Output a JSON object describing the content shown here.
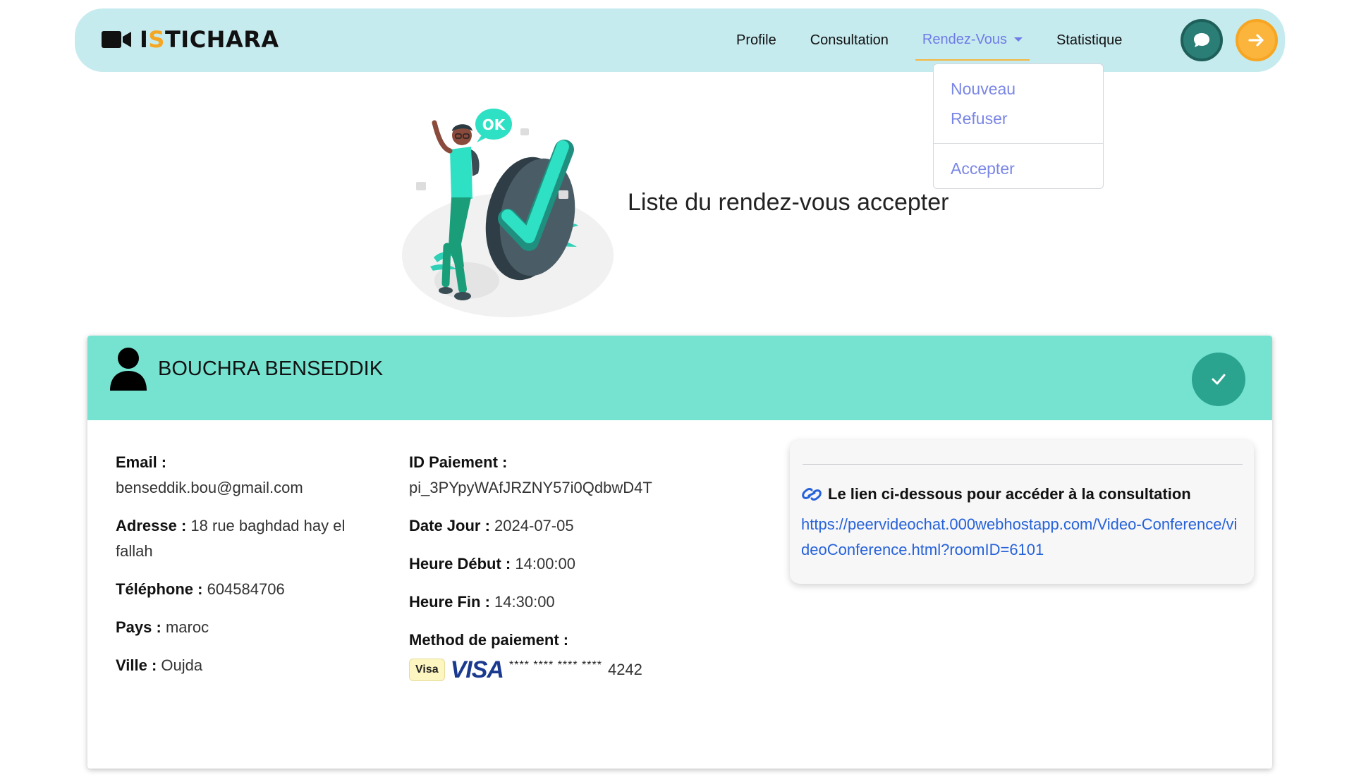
{
  "brand": {
    "prefix": "I",
    "accent": "S",
    "rest": "TICHARA",
    "icon": "video-camera-icon"
  },
  "nav": {
    "items": [
      {
        "label": "Profile"
      },
      {
        "label": "Consultation"
      },
      {
        "label": "Rendez-Vous",
        "active": true
      },
      {
        "label": "Statistique"
      }
    ],
    "chat_icon": "chat-bubble-icon",
    "logout_icon": "arrow-right-icon"
  },
  "dropdown": {
    "items": [
      {
        "label": "Nouveau"
      },
      {
        "label": "Refuser"
      },
      {
        "label": "Accepter"
      }
    ]
  },
  "hero": {
    "title": "Liste du rendez-vous accepter",
    "bubble": "OK"
  },
  "card": {
    "name": "BOUCHRA BENSEDDIK",
    "status_icon": "check-icon",
    "patient": {
      "email_label": "Email :",
      "email": "benseddik.bou@gmail.com",
      "address_label": "Adresse :",
      "address": "18 rue baghdad hay el fallah",
      "phone_label": "Téléphone :",
      "phone": "604584706",
      "country_label": "Pays :",
      "country": "maroc",
      "city_label": "Ville :",
      "city": "Oujda"
    },
    "payment": {
      "id_label": "ID Paiement :",
      "id": "pi_3PYpyWAfJRZNY57i0QdbwD4T",
      "date_label": "Date Jour :",
      "date": "2024-07-05",
      "start_label": "Heure Début :",
      "start": "14:00:00",
      "end_label": "Heure Fin :",
      "end": "14:30:00",
      "method_label": "Method de paiement :",
      "brand_chip": "Visa",
      "brand_logo": "VISA",
      "masked": "**** **** **** ****",
      "last4": "4242"
    },
    "link": {
      "title": "Le lien ci-dessous pour accéder à la consultation",
      "url": "https://peervideochat.000webhostapp.com/Video-Conference/videoConference.html?roomID=6101",
      "icon": "link-icon"
    }
  },
  "colors": {
    "navbar_bg": "#c6ebef",
    "accent_orange": "#f5a623",
    "nav_active": "#6f7be6",
    "card_header": "#76e3d1",
    "status_green": "#2aa38f",
    "link_blue": "#2662d9"
  }
}
